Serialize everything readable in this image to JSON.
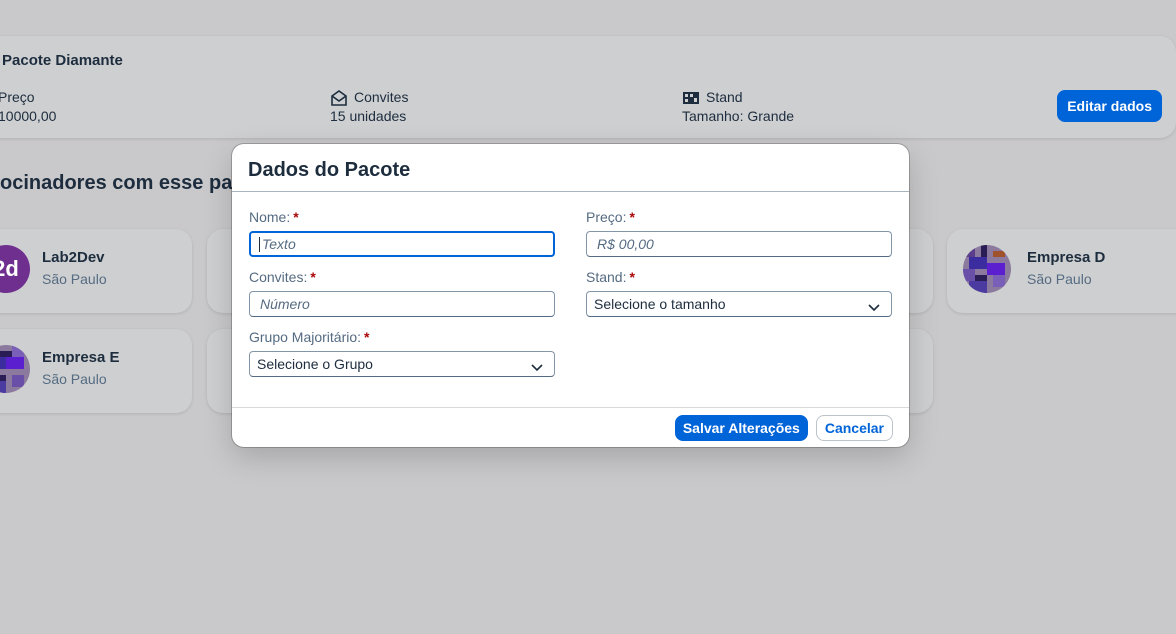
{
  "package": {
    "title": "Pacote Diamante",
    "preco_label": "Preço",
    "preco_value": "10000,00",
    "convites_label": "Convites",
    "convites_value": "15 unidades",
    "stand_label": "Stand",
    "stand_value": "Tamanho: Grande",
    "edit_button": "Editar dados"
  },
  "section_title": "ocinadores com esse pacote",
  "sponsors": [
    {
      "name": "Lab2Dev",
      "city": "São Paulo",
      "avatar_text": "2d",
      "avatar_color": "#6e2f8f"
    },
    {
      "name": "Empresa D",
      "city": "São Paulo"
    },
    {
      "name": "Empresa E",
      "city": "São Paulo"
    }
  ],
  "dialog": {
    "title": "Dados do Pacote",
    "fields": {
      "nome": {
        "label": "Nome:",
        "placeholder": "Texto"
      },
      "preco": {
        "label": "Preço:",
        "placeholder": "R$ 00,00"
      },
      "convites": {
        "label": "Convites:",
        "placeholder": "Número"
      },
      "stand": {
        "label": "Stand:",
        "value": "Selecione o tamanho"
      },
      "grupo": {
        "label": "Grupo Majoritário:",
        "value": "Selecione o Grupo"
      }
    },
    "required_mark": "*",
    "save_button": "Salvar Alterações",
    "cancel_button": "Cancelar"
  },
  "colors": {
    "accent": "#0064d9",
    "required": "#aa0808",
    "overlay_bg": "#c9c9cb"
  }
}
